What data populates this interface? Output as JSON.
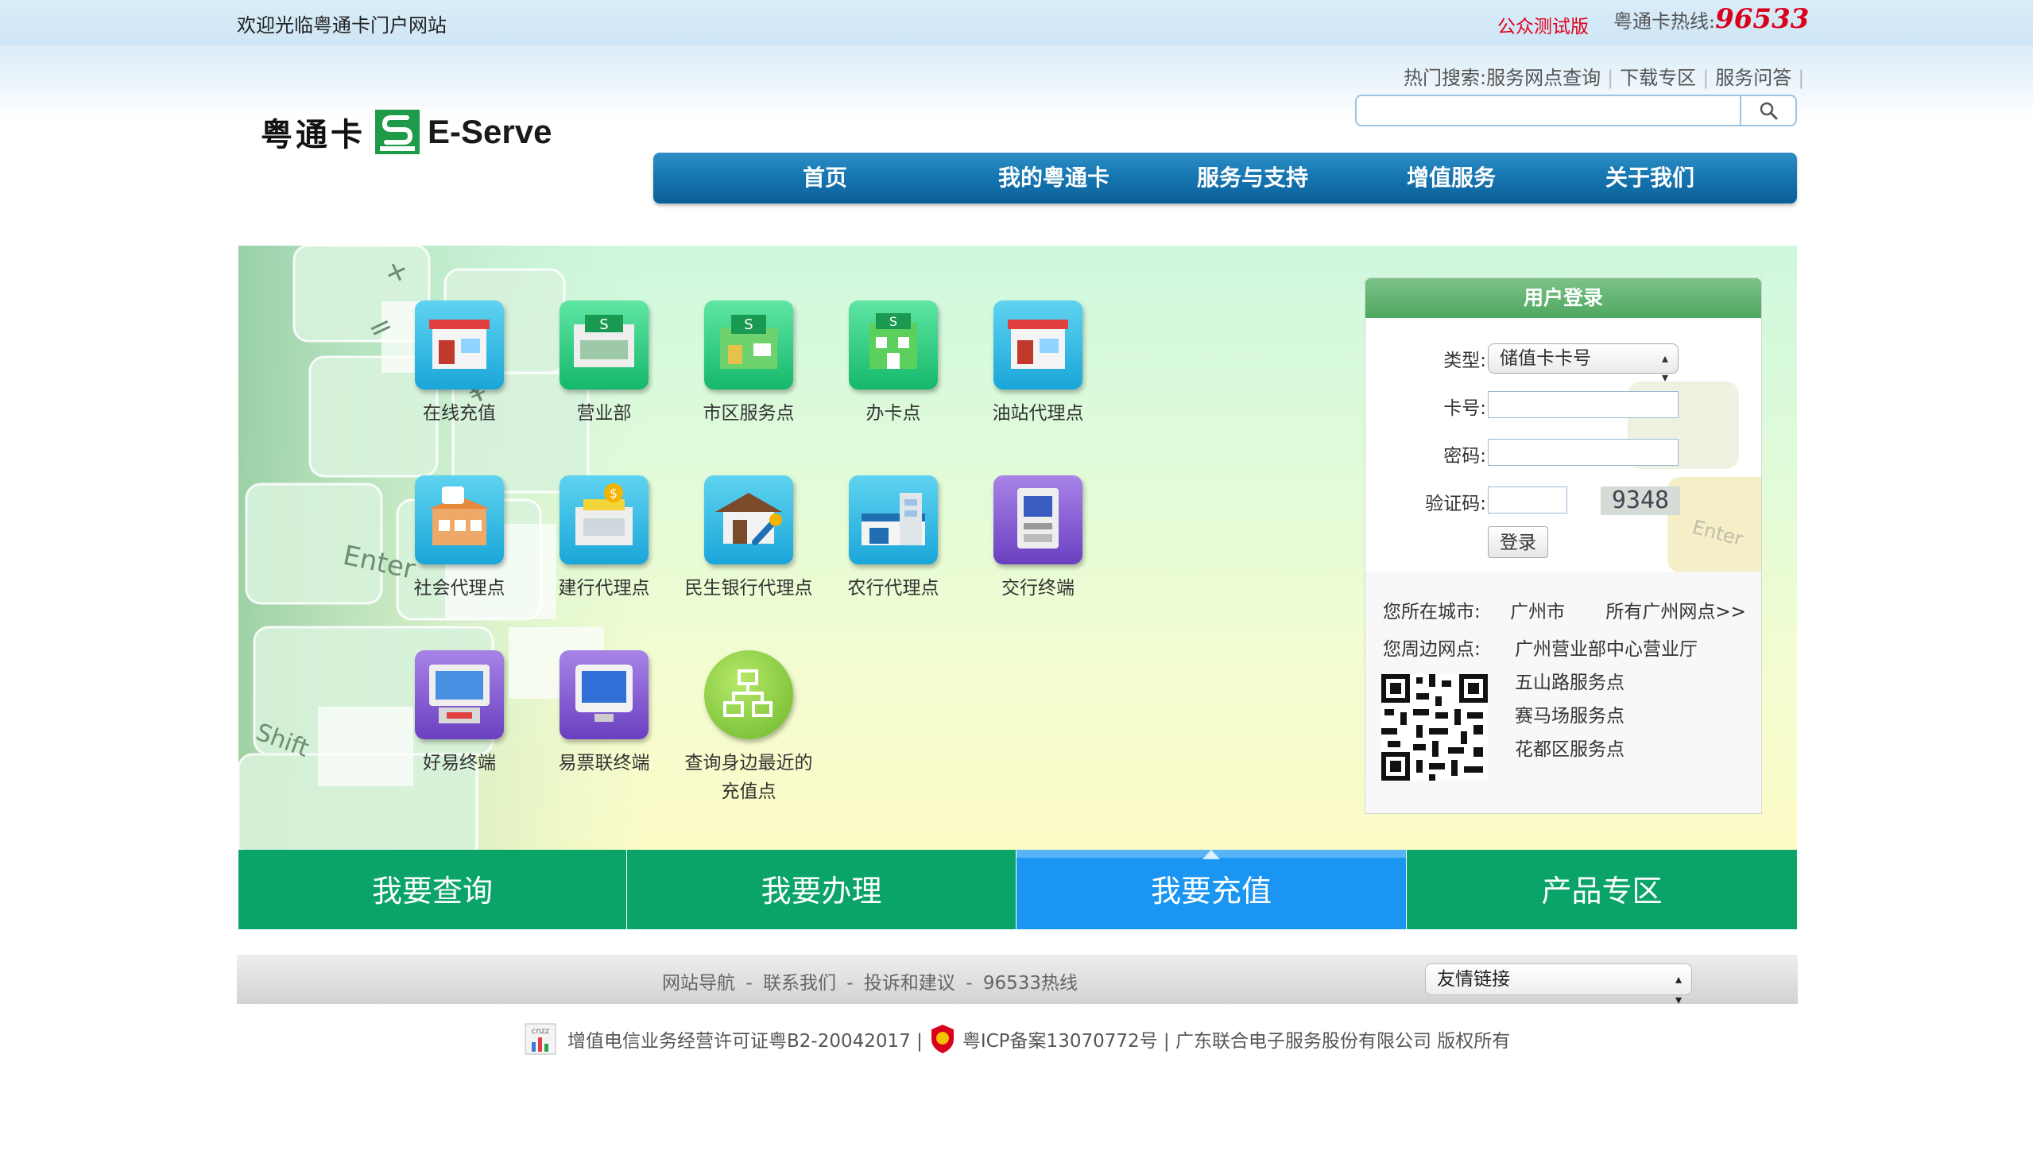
{
  "topbar": {
    "welcome": "欢迎光临粤通卡门户网站",
    "beta": "公众测试版",
    "hotline_label": "粤通卡热线:",
    "hotline_number": "96533"
  },
  "logo": {
    "cn": "粤通卡",
    "en": "E-Serve"
  },
  "hot_search": {
    "label": "热门搜索:",
    "links": [
      "服务网点查询",
      "下载专区",
      "服务问答"
    ]
  },
  "search": {
    "value": ""
  },
  "nav": [
    "首页",
    "我的粤通卡",
    "服务与支持",
    "增值服务",
    "关于我们"
  ],
  "services": [
    {
      "label": "在线充值",
      "icon": "store-icon"
    },
    {
      "label": "营业部",
      "icon": "business-hall-icon"
    },
    {
      "label": "市区服务点",
      "icon": "service-point-icon"
    },
    {
      "label": "办卡点",
      "icon": "card-office-icon"
    },
    {
      "label": "油站代理点",
      "icon": "gas-station-icon"
    },
    {
      "label": "社会代理点",
      "icon": "cafe-icon"
    },
    {
      "label": "建行代理点",
      "icon": "ccb-bank-icon"
    },
    {
      "label": "民生银行代理点",
      "icon": "cmbc-bank-icon"
    },
    {
      "label": "农行代理点",
      "icon": "abc-bank-icon"
    },
    {
      "label": "交行终端",
      "icon": "atm-terminal-icon"
    },
    {
      "label": "好易终端",
      "icon": "kiosk-terminal-icon"
    },
    {
      "label": "易票联终端",
      "icon": "monitor-terminal-icon"
    },
    {
      "label": "查询身边最近的",
      "label2": "充值点",
      "icon": "network-icon"
    }
  ],
  "login": {
    "title": "用户登录",
    "type_label": "类型:",
    "type_value": "储值卡卡号",
    "card_label": "卡号:",
    "card_value": "",
    "password_label": "密码:",
    "password_value": "",
    "captcha_label": "验证码:",
    "captcha_value": "",
    "captcha_text": "9348",
    "submit": "登录",
    "city_label": "您所在城市:",
    "city": "广州市",
    "all_points": "所有广州网点>>",
    "nearby_label": "您周边网点:",
    "nearby": [
      "广州营业部中心营业厅",
      "五山路服务点",
      "赛马场服务点",
      "花都区服务点"
    ]
  },
  "tabs": [
    "我要查询",
    "我要办理",
    "我要充值",
    "产品专区"
  ],
  "active_tab": "我要充值",
  "footer": {
    "links": [
      "网站导航",
      "联系我们",
      "投诉和建议",
      "96533热线"
    ],
    "separator": "-",
    "friend_links": "友情链接",
    "license": "增值电信业务经营许可证粤B2-20042017 |",
    "icp": "粤ICP备案13070772号 | 广东联合电子服务股份有限公司 版权所有"
  },
  "colors": {
    "nav_blue": "#1677b2",
    "tab_green": "#0aa468",
    "tab_active_blue": "#1a96f2",
    "beta_red": "#e0001a",
    "login_header_green": "#5cb06c"
  }
}
